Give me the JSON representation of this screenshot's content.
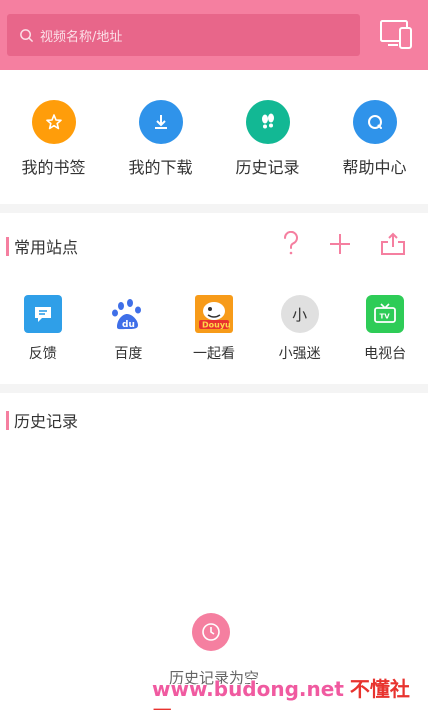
{
  "search": {
    "placeholder": "视频名称/地址"
  },
  "quick_actions": [
    {
      "label": "我的书签",
      "icon": "bookmark-star-icon",
      "color": "#ff9d0a"
    },
    {
      "label": "我的下载",
      "icon": "download-icon",
      "color": "#2f93ea"
    },
    {
      "label": "历史记录",
      "icon": "footprints-icon",
      "color": "#12b894"
    },
    {
      "label": "帮助中心",
      "icon": "help-chat-icon",
      "color": "#2f93ea"
    }
  ],
  "common_sites": {
    "title": "常用站点",
    "items": [
      {
        "label": "反馈",
        "icon": "feedback-icon",
        "color": "#2f9fe8"
      },
      {
        "label": "百度",
        "icon": "baidu-paw-icon",
        "color": "#3f6fe8"
      },
      {
        "label": "一起看",
        "icon": "douyu-fish-icon",
        "color": "#f79b19"
      },
      {
        "label": "小强迷",
        "icon": "text-avatar-icon",
        "avatar_text": "小",
        "color": "#e0e0e0"
      },
      {
        "label": "电视台",
        "icon": "tv-icon",
        "color": "#2ecc57"
      }
    ]
  },
  "history": {
    "title": "历史记录",
    "empty_text": "历史记录为空"
  },
  "watermark": {
    "url": "www.budong.net",
    "name": "不懂社区"
  },
  "colors": {
    "accent": "#f57fa0",
    "accent_dark": "#e8668a"
  }
}
